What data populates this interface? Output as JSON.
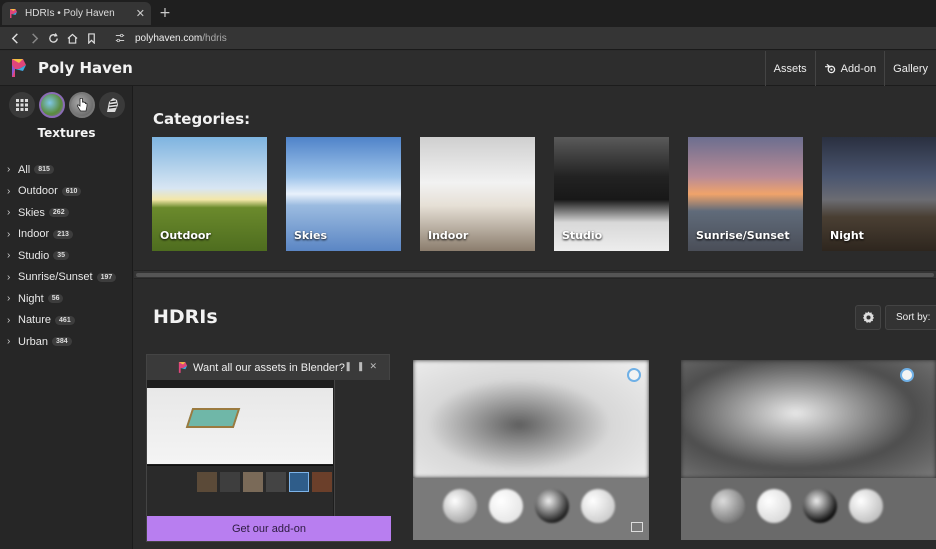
{
  "browser": {
    "tab_title": "HDRIs • Poly Haven",
    "tab_close": "✕",
    "new_tab": "+",
    "url_host": "polyhaven.com",
    "url_path": "/hdris"
  },
  "header": {
    "brand": "Poly Haven",
    "nav": [
      "Assets",
      "Add-on",
      "Gallery"
    ]
  },
  "sidebar": {
    "title": "Textures",
    "categories": [
      {
        "label": "All",
        "count": "815"
      },
      {
        "label": "Outdoor",
        "count": "610"
      },
      {
        "label": "Skies",
        "count": "262"
      },
      {
        "label": "Indoor",
        "count": "213"
      },
      {
        "label": "Studio",
        "count": "35"
      },
      {
        "label": "Sunrise/Sunset",
        "count": "197"
      },
      {
        "label": "Night",
        "count": "56"
      },
      {
        "label": "Nature",
        "count": "461"
      },
      {
        "label": "Urban",
        "count": "384"
      }
    ]
  },
  "main": {
    "categories_heading": "Categories:",
    "category_cards": [
      "Outdoor",
      "Skies",
      "Indoor",
      "Studio",
      "Sunrise/Sunset",
      "Night"
    ],
    "hdris_heading": "HDRIs",
    "sort_label": "Sort by:",
    "promo": {
      "title": "Want all our assets in Blender?",
      "button": "Get our add-on"
    }
  },
  "colors": {
    "accent_purple": "#b87ef0",
    "background": "#2b2b2b",
    "sidebar": "#262626"
  }
}
